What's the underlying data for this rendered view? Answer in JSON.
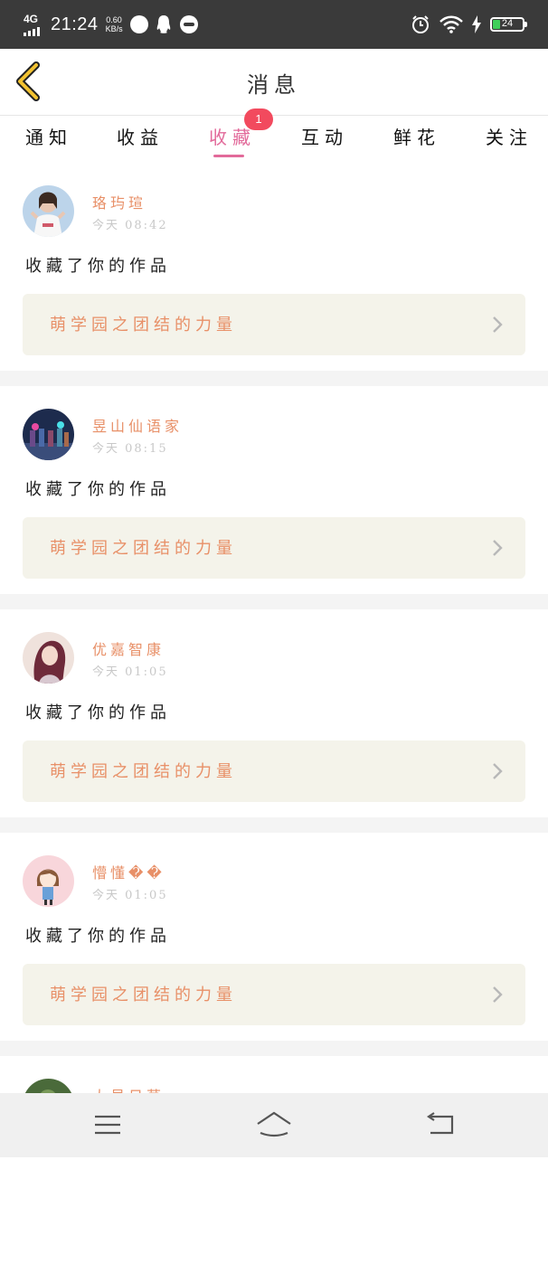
{
  "status_bar": {
    "network": "4G",
    "time": "21:24",
    "speed_value": "0.60",
    "speed_unit": "KB/s",
    "battery": "24"
  },
  "header": {
    "title": "消息",
    "back_icon": "chevron-left-icon"
  },
  "tabs": [
    {
      "label": "通知"
    },
    {
      "label": "收益"
    },
    {
      "label": "收藏",
      "active": true,
      "badge": "1"
    },
    {
      "label": "互动"
    },
    {
      "label": "鲜花"
    },
    {
      "label": "关注"
    }
  ],
  "feed": [
    {
      "name": "珞玙瑄",
      "time": "今天 08:42",
      "action": "收藏了你的作品",
      "work": "萌学园之团结的力量"
    },
    {
      "name": "昱山仙语家",
      "time": "今天 08:15",
      "action": "收藏了你的作品",
      "work": "萌学园之团结的力量"
    },
    {
      "name": "优嘉智康",
      "time": "今天 01:05",
      "action": "收藏了你的作品",
      "work": "萌学园之团结的力量"
    },
    {
      "name": "懵懂��",
      "time": "今天 01:05",
      "action": "收藏了你的作品",
      "work": "萌学园之团结的力量"
    }
  ],
  "partial_item": {
    "name": "大易日草"
  },
  "colors": {
    "accent": "#e26a9a",
    "name": "#e89068",
    "badge": "#f24a5e",
    "work_bg": "#f4f3ea",
    "back_arrow": "#f2c230"
  },
  "nav": {
    "menu_icon": "menu-icon",
    "home_icon": "home-icon",
    "back_icon": "back-arrow-icon"
  }
}
